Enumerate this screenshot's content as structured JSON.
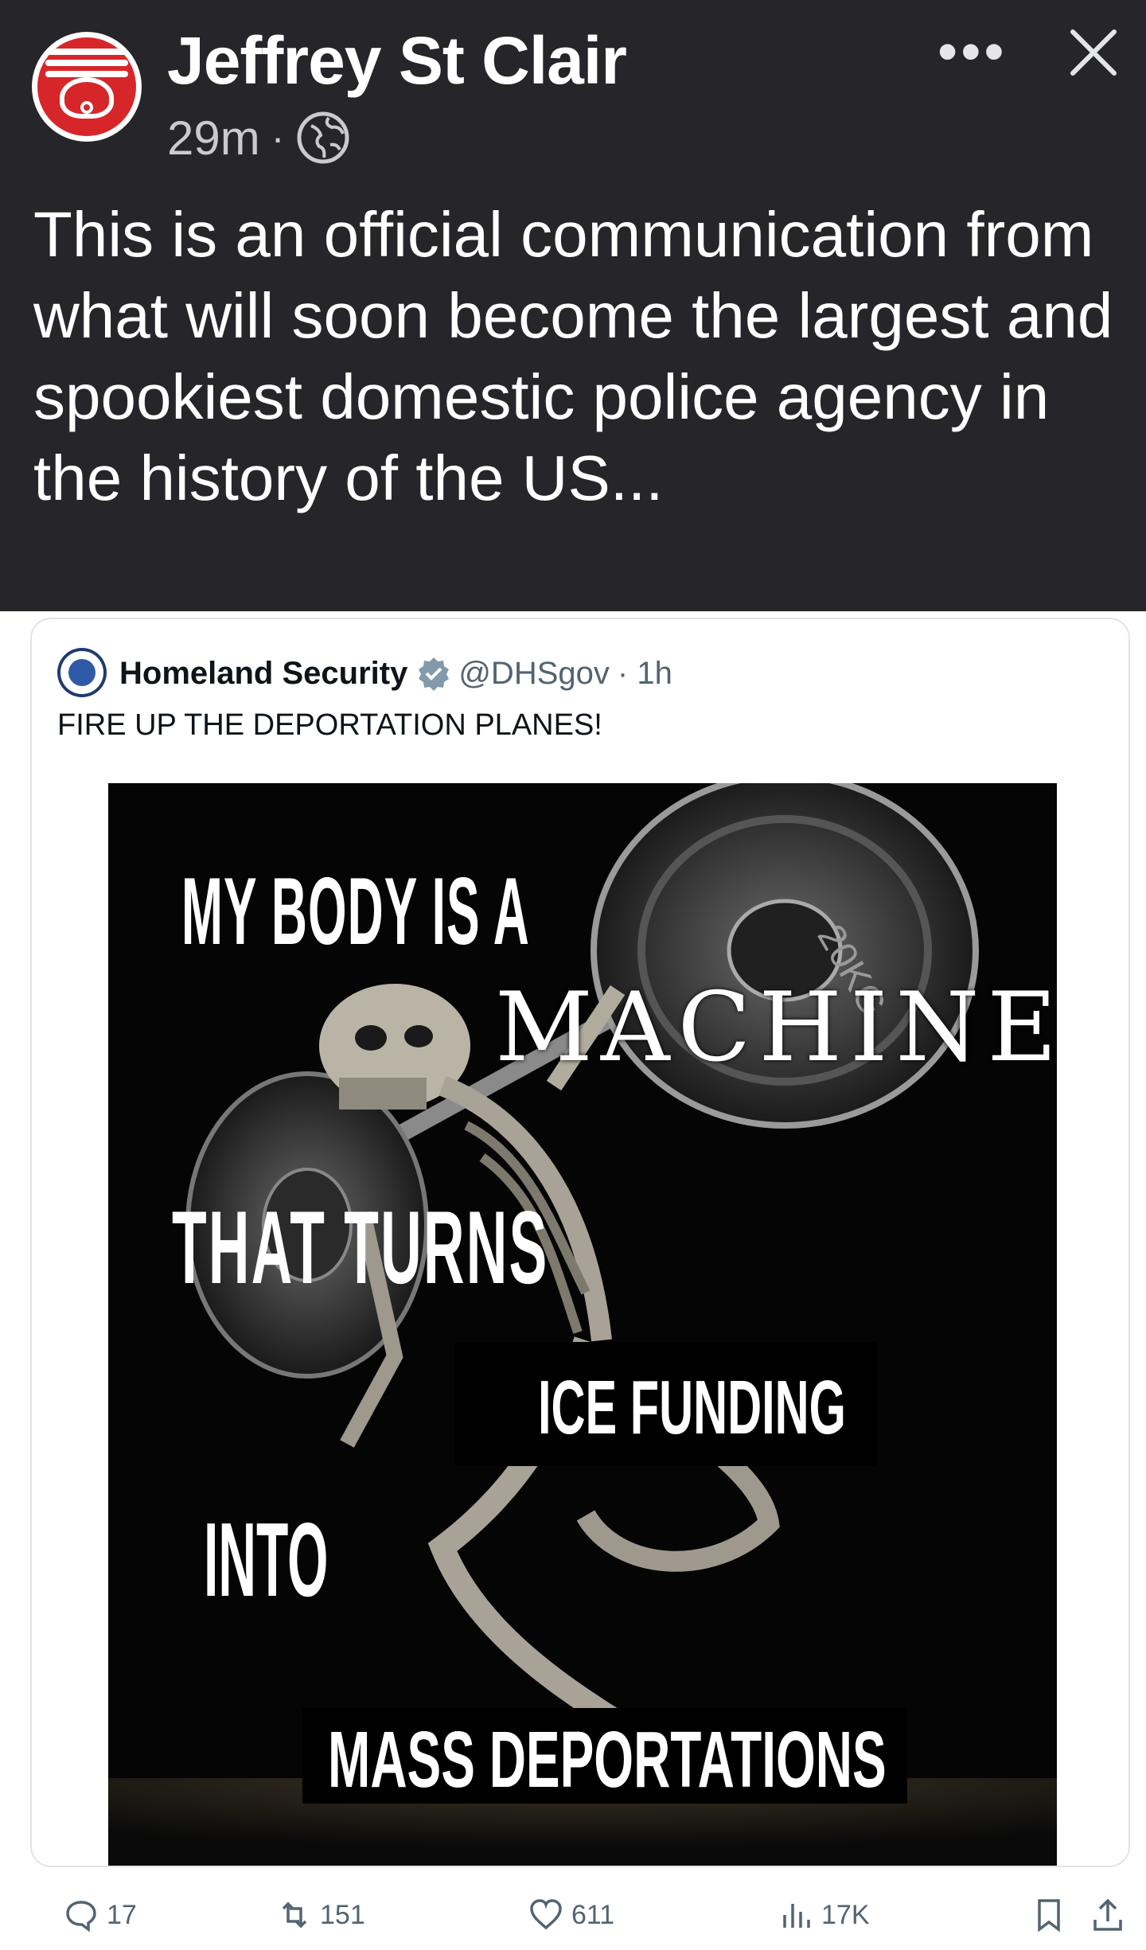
{
  "post": {
    "author": "Jeffrey St Clair",
    "time": "29m",
    "separator": "·",
    "more_label": "•••",
    "text": "This is an official communication from what will soon become the largest and spookiest domestic police agency in the history of the US...",
    "icons": {
      "avatar": "red-logo-avatar",
      "globe": "globe-icon",
      "close": "close-icon",
      "more": "more-options-icon"
    }
  },
  "tweet": {
    "name": "Homeland Security",
    "handle": "@DHSgov",
    "time_suffix": "· 1h",
    "text": "FIRE UP THE DEPORTATION PLANES!",
    "meme": {
      "line1": "MY BODY IS A",
      "line2": "MACHINE",
      "line3": "THAT TURNS",
      "line4": "ICE FUNDING",
      "line5": "INTO",
      "line6": "MASS DEPORTATIONS",
      "plate_text": "20KG"
    },
    "actions": {
      "replies": "17",
      "reposts": "151",
      "likes": "611",
      "views": "17K"
    }
  }
}
